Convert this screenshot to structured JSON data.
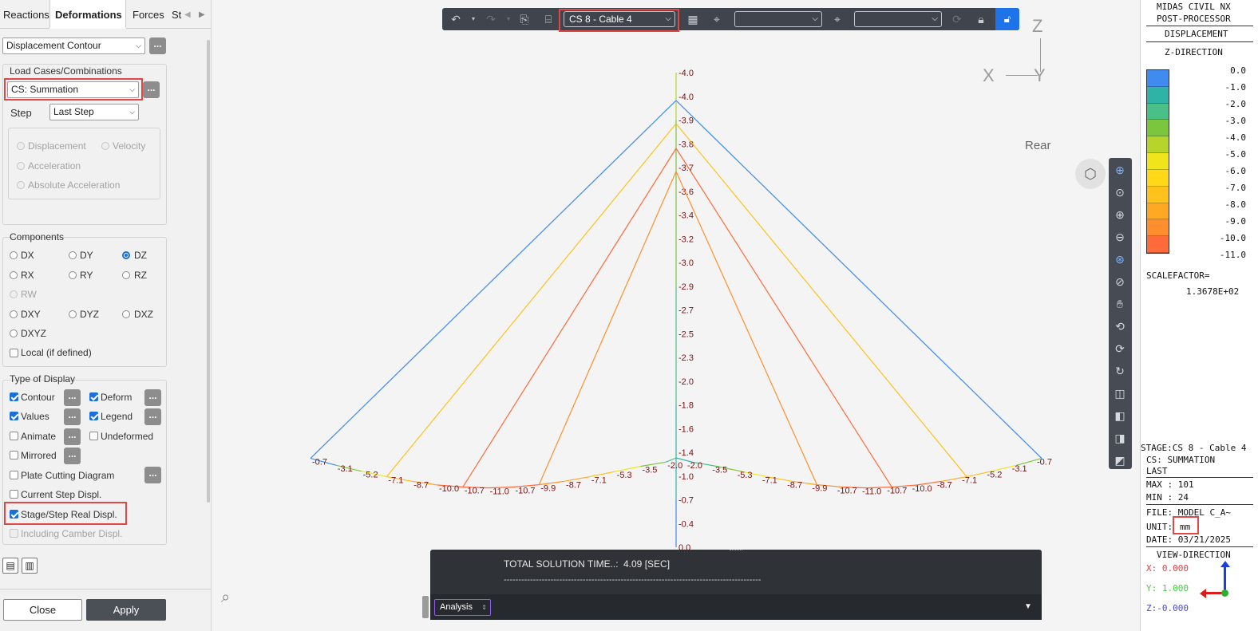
{
  "tabs": [
    "Reactions",
    "Deformations",
    "Forces",
    "St"
  ],
  "panel": {
    "result_type": "Displacement Contour",
    "load_cases_label": "Load Cases/Combinations",
    "load_case": "CS: Summation",
    "step_label": "Step",
    "step_value": "Last Step",
    "motion_options": [
      "Displacement",
      "Velocity",
      "Acceleration",
      "Absolute Acceleration"
    ],
    "components_label": "Components",
    "components": [
      "DX",
      "DY",
      "DZ",
      "RX",
      "RY",
      "RZ",
      "RW",
      "DXY",
      "DYZ",
      "DXZ",
      "DXYZ"
    ],
    "components_selected": "DZ",
    "local_label": "Local (if defined)",
    "display_label": "Type of Display",
    "display_options": [
      {
        "label": "Contour",
        "checked": true
      },
      {
        "label": "Deform",
        "checked": true
      },
      {
        "label": "Values",
        "checked": true
      },
      {
        "label": "Legend",
        "checked": true
      },
      {
        "label": "Animate",
        "checked": false
      },
      {
        "label": "Undeformed",
        "checked": false
      },
      {
        "label": "Mirrored",
        "checked": false
      },
      {
        "label": "Plate Cutting Diagram",
        "checked": false
      },
      {
        "label": "Current Step Displ.",
        "checked": false
      },
      {
        "label": "Stage/Step Real Displ.",
        "checked": true
      },
      {
        "label": "Including Camber Displ.",
        "checked": false
      }
    ],
    "close_label": "Close",
    "apply_label": "Apply",
    "dots": "..."
  },
  "toolbar": {
    "stage_select": "CS 8 - Cable 4",
    "select2": "",
    "select3": ""
  },
  "viewport": {
    "axis_z": "Z",
    "axis_x": "X",
    "axis_y": "Y",
    "view_label": "Rear",
    "center_values": [
      "-4.0",
      "-4.0",
      "-3.9",
      "-3.8",
      "-3.7",
      "-3.6",
      "-3.4",
      "-3.2",
      "-3.0",
      "-2.9",
      "-2.7",
      "-2.5",
      "-2.3",
      "-2.0",
      "-1.8",
      "-1.6",
      "-1.4",
      "-1.0",
      "-0.7",
      "-0.4",
      "0.0"
    ],
    "deck_values_left": [
      "-0.7",
      "-3.1",
      "-5.2",
      "-7.1",
      "-8.7",
      "-10.0",
      "-10.7",
      "-11.0",
      "-10.7",
      "-9.9",
      "-8.7",
      "-7.1",
      "-5.3",
      "-3.5",
      "-2.0"
    ],
    "deck_values_right": [
      "-2.0",
      "-3.5",
      "-5.3",
      "-7.1",
      "-8.7",
      "-9.9",
      "-10.7",
      "-11.0",
      "-10.7",
      "-10.0",
      "-8.7",
      "-7.1",
      "-5.2",
      "-3.1",
      "-0.7"
    ]
  },
  "console": {
    "line1_label": "TOTAL SOLUTION TIME..:",
    "line1_value": "4.09 [SEC]",
    "line2": "----------------------------------------------------------------------------------------",
    "tab": "Analysis"
  },
  "legend": {
    "title1": "MIDAS CIVIL NX",
    "title2": "POST-PROCESSOR",
    "type": "DISPLACEMENT",
    "direction": "Z-DIRECTION",
    "values": [
      "0.0",
      "-1.0",
      "-2.0",
      "-3.0",
      "-4.0",
      "-5.0",
      "-6.0",
      "-7.0",
      "-8.0",
      "-9.0",
      "-10.0",
      "-11.0"
    ],
    "colors": [
      "#3f8bf0",
      "#2fb3a6",
      "#4ac088",
      "#7cc63e",
      "#b6d42a",
      "#f0e41c",
      "#ffd81a",
      "#ffc11c",
      "#ffa824",
      "#ff8e2e",
      "#ff6a3a"
    ],
    "scalefactor_label": "SCALEFACTOR=",
    "scalefactor_value": "1.3678E+02",
    "stage": "STAGE:CS 8 - Cable 4",
    "cs": "CS: SUMMATION",
    "step": "LAST",
    "max": "MAX : 101",
    "min": "MIN : 24",
    "file": "FILE: MODEL C_A~",
    "unit_label": "UNIT:",
    "unit_value": "mm",
    "date": "DATE: 03/21/2025",
    "view_dir": "VIEW-DIRECTION",
    "vx": "X: 0.000",
    "vy": "Y: 1.000",
    "vz": "Z:-0.000"
  }
}
